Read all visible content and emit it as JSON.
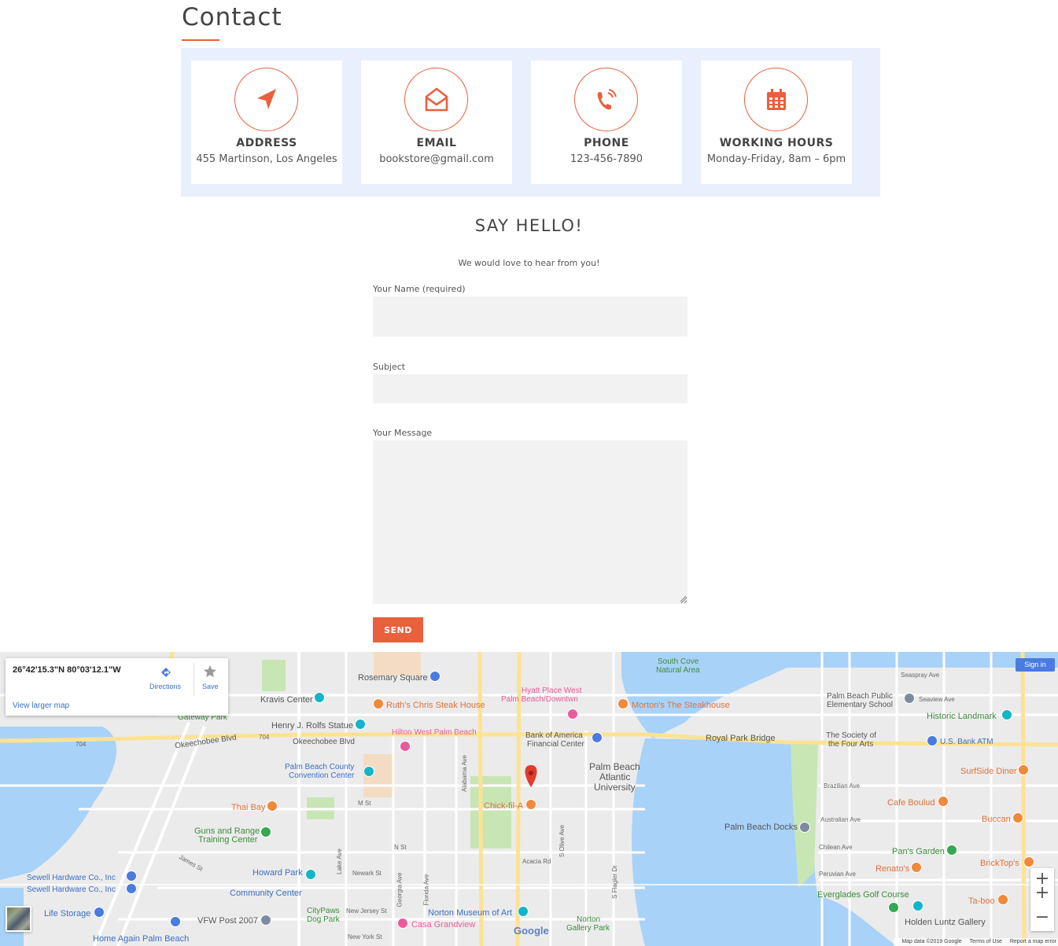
{
  "page": {
    "heading": "Contact",
    "accent_color": "#e8603c",
    "panel_color": "#e9effd"
  },
  "cards": [
    {
      "icon": "location-arrow-icon",
      "title": "ADDRESS",
      "value": "455 Martinson, Los Angeles"
    },
    {
      "icon": "envelope-open-icon",
      "title": "EMAIL",
      "value": "bookstore@gmail.com"
    },
    {
      "icon": "phone-volume-icon",
      "title": "PHONE",
      "value": "123-456-7890"
    },
    {
      "icon": "calendar-icon",
      "title": "WORKING HOURS",
      "value": "Monday-Friday, 8am – 6pm"
    }
  ],
  "form": {
    "title": "SAY HELLO!",
    "subtitle": "We would love to hear from you!",
    "name_label": "Your Name (required)",
    "name_value": "",
    "subject_label": "Subject",
    "subject_value": "",
    "message_label": "Your Message",
    "message_value": "",
    "send_label": "SEND"
  },
  "map": {
    "infobox": {
      "coords": "26°42'15.3\"N 80°03'12.1\"W",
      "directions_label": "Directions",
      "save_label": "Save",
      "view_larger": "View larger map"
    },
    "signin_label": "Sign in",
    "zoom_in": "+",
    "zoom_out": "−",
    "google_logo": "Google",
    "footer": {
      "map_data": "Map data ©2019 Google",
      "terms": "Terms of Use",
      "report": "Report a map error"
    },
    "labels": {
      "south_cove": "South Cove",
      "natural_area": "Natural Area",
      "rosemary_square": "Rosemary Square",
      "kravis_center": "Kravis Center",
      "ruths_chris": "Ruth's Chris Steak House",
      "hyatt_1": "Hyatt Place West",
      "hyatt_2": "Palm Beach/Downtwn",
      "mortons": "Morton's The Steakhouse",
      "pb_public_1": "Palm Beach Public",
      "pb_public_2": "Elementary School",
      "historic_landmark": "Historic Landmark",
      "gateway_park": "Gateway Park",
      "henry_flagler": "Henry J. Rolfs Statue",
      "hilton": "Hilton West Palm Beach",
      "boa_1": "Bank of America",
      "boa_2": "Financial Center",
      "royal_park_bridge": "Royal Park Bridge",
      "society_1": "The Society of",
      "society_2": "the Four Arts",
      "us_bank": "U.S. Bank ATM",
      "okeechobee_1": "Okeechobee Blvd",
      "okeechobee_2": "Okeechobee Blvd",
      "convention_1": "Palm Beach County",
      "convention_2": "Convention Center",
      "pba_1": "Palm Beach",
      "pba_2": "Atlantic",
      "pba_3": "University",
      "surfside": "SurfSide Diner",
      "thai_bay": "Thai Bay",
      "chick_fil_a": "Chick-fil-A",
      "cafe_boulud": "Cafe Boulud",
      "pb_docks": "Palm Beach Docks",
      "buccan": "Buccan",
      "guns_1": "Guns and Range",
      "guns_2": "Training Center",
      "pans_garden": "Pan's Garden",
      "renatos": "Renato's",
      "bricktops": "BrickTop's",
      "sewell_1": "Sewell Hardware Co., Inc",
      "sewell_2": "Sewell Hardware Co., Inc",
      "howard_1": "Howard Park",
      "howard_2": "Community Center",
      "everglades": "Everglades Golf Course",
      "taboo": "Ta-boo",
      "life_storage": "Life Storage",
      "vfw": "VFW Post 2007",
      "citypaws_1": "CityPaws",
      "citypaws_2": "Dog Park",
      "norton_museum": "Norton Museum of Art",
      "casa": "Casa Grandview",
      "norton_gallery_1": "Norton",
      "norton_gallery_2": "Gallery Park",
      "holden": "Holden Luntz Gallery",
      "home_again": "Home Again Palm Beach",
      "seaspray": "Seaspray Ave",
      "seaview": "Seaview Ave",
      "brazilian": "Brazilian Ave",
      "australian": "Australian Ave",
      "chilean": "Chilean Ave",
      "peruvian": "Peruvian Ave",
      "m_st": "M St",
      "n_st": "N St",
      "newark": "Newark St",
      "new_jersey": "New Jersey St",
      "new_york": "New York St",
      "acacia": "Acacia Rd",
      "james": "James St",
      "s_olive": "S Olive Ave",
      "s_flagler": "S Flagler Dr",
      "alabama": "Alabama Ave",
      "florida": "Florida Ave",
      "georgia": "Georgia Ave",
      "lake_ave": "Lake Ave",
      "route_704": "704"
    }
  }
}
